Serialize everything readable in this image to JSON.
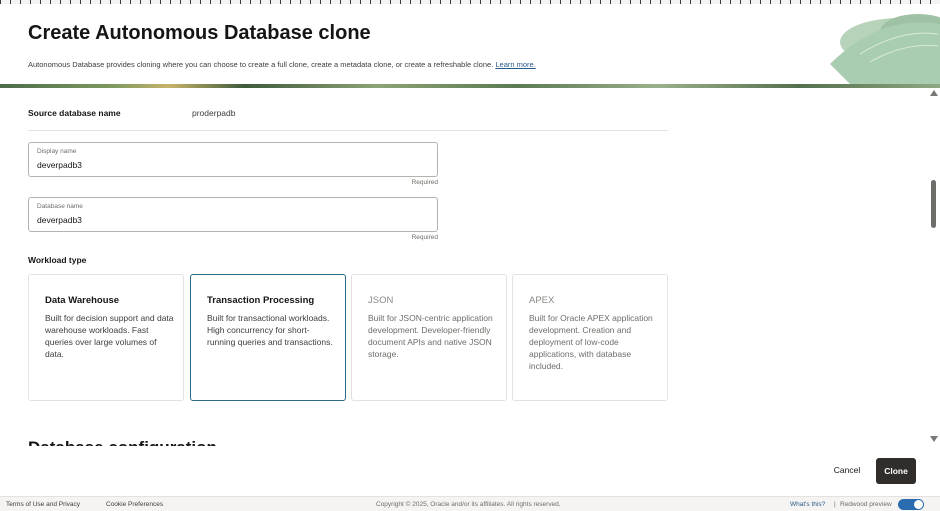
{
  "header": {
    "title": "Create Autonomous Database clone",
    "description": "Autonomous Database provides cloning where you can choose to create a full clone, create a metadata clone, or create a refreshable clone.",
    "learn_more": "Learn more."
  },
  "source": {
    "label": "Source database name",
    "value": "proderpadb"
  },
  "display_name": {
    "label": "Display name",
    "value": "deverpadb3",
    "required": "Required"
  },
  "database_name": {
    "label": "Database name",
    "value": "deverpadb3",
    "required": "Required"
  },
  "workload": {
    "label": "Workload type",
    "selected": "Transaction Processing",
    "cards": [
      {
        "title": "Data Warehouse",
        "desc": "Built for decision support and data warehouse workloads. Fast queries over large volumes of data.",
        "state": "enabled"
      },
      {
        "title": "Transaction Processing",
        "desc": "Built for transactional workloads. High concurrency for short-running queries and transactions.",
        "state": "selected"
      },
      {
        "title": "JSON",
        "desc": "Built for JSON-centric application development. Developer-friendly document APIs and native JSON storage.",
        "state": "disabled"
      },
      {
        "title": "APEX",
        "desc": "Built for Oracle APEX application development. Creation and deployment of low-code applications, with database included.",
        "state": "disabled"
      }
    ]
  },
  "next_section": "Database configuration",
  "actions": {
    "cancel": "Cancel",
    "clone": "Clone"
  },
  "footer": {
    "terms": "Terms of Use and Privacy",
    "cookies": "Cookie Preferences",
    "copyright": "Copyright © 2025, Oracle and/or its affiliates. All rights reserved.",
    "whats_this": "What's this?",
    "separator": "|",
    "redwood": "Redwood preview",
    "redwood_enabled": true
  },
  "colors": {
    "selected_border": "#2b6a8a",
    "primary_button": "#312d2a",
    "toggle": "#2b6cb0"
  }
}
